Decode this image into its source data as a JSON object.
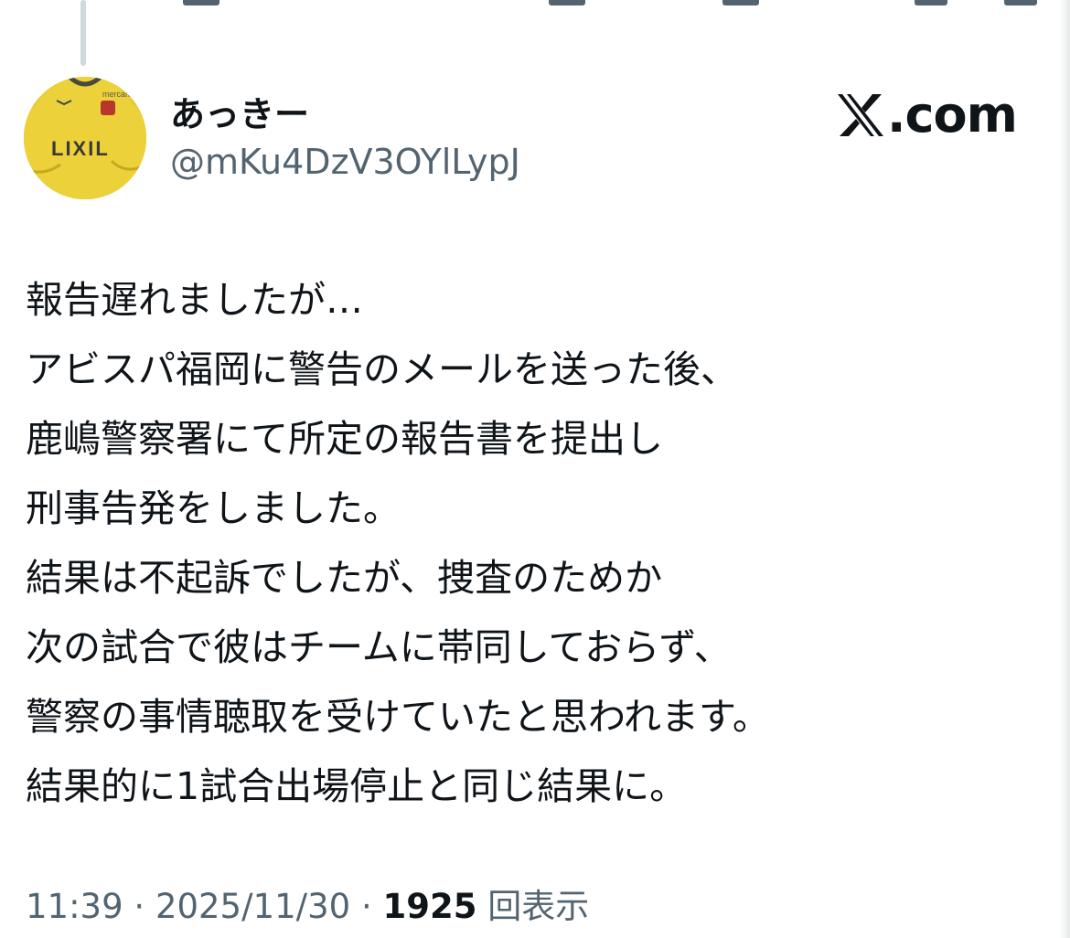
{
  "author": {
    "display_name": "あっきー",
    "handle": "@mKu4DzV3OYlLypJ",
    "avatar_shirt_text": "LIXIL",
    "avatar_shirt_sponsor": "mercari"
  },
  "brand": {
    "label": "X.com",
    "text_after_logo": ".com"
  },
  "tweet": {
    "lines": [
      "報告遅れましたが…",
      "アビスパ福岡に警告のメールを送った後、",
      "鹿嶋警察署にて所定の報告書を提出し",
      "刑事告発をしました。",
      "結果は不起訴でしたが、捜査のためか",
      "次の試合で彼はチームに帯同しておらず、",
      "警察の事情聴取を受けていたと思われます。",
      "結果的に1試合出場停止と同じ結果に。"
    ]
  },
  "meta": {
    "time": "11:39",
    "separator": " · ",
    "date": "2025/11/30",
    "views_count": "1925",
    "views_label": "回表示"
  },
  "colors": {
    "text": "#0f1419",
    "secondary": "#536471",
    "thread_line": "#cfd9de",
    "avatar_yellow": "#e9c832"
  }
}
